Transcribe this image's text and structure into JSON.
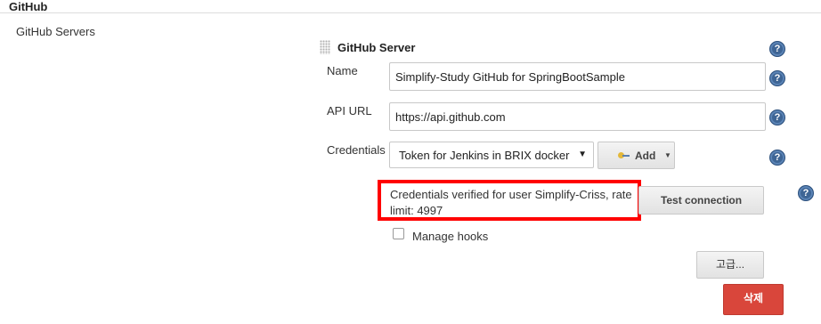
{
  "section": {
    "title": "GitHub"
  },
  "servers": {
    "label": "GitHub Servers"
  },
  "server": {
    "title": "GitHub Server",
    "name_label": "Name",
    "name_value": "Simplify-Study GitHub for SpringBootSample",
    "api_url_label": "API URL",
    "api_url_value": "https://api.github.com",
    "credentials_label": "Credentials",
    "credentials_selected": "Token for Jenkins in BRIX docker",
    "add_label": "Add",
    "verify_message": "Credentials verified for user Simplify-Criss, rate limit: 4997",
    "test_connection_label": "Test connection",
    "manage_hooks_label": "Manage hooks",
    "manage_hooks_checked": false,
    "advanced_label": "고급...",
    "delete_label": "삭제"
  },
  "help_glyph": "?",
  "colors": {
    "help_blue": "#3e6595",
    "highlight_red": "#ff0000",
    "delete_red": "#d9463b",
    "key_yellow": "#e3b83a"
  },
  "icons": [
    "help-icon",
    "drag-handle-icon",
    "key-icon",
    "caret-down-icon"
  ]
}
